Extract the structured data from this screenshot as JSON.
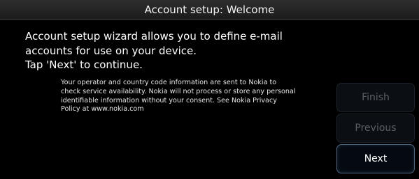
{
  "window": {
    "title": "Account setup: Welcome"
  },
  "main": {
    "intro_lines": [
      "Account setup wizard allows you to define e-mail",
      "accounts for use on your device.",
      "Tap 'Next' to continue."
    ],
    "notice_lines": [
      "Your operator and country code information are sent to Nokia to",
      "check service availability. Nokia will not process or store any personal",
      "identifiable information without your consent. See Nokia Privacy",
      "Policy at www.nokia.com"
    ]
  },
  "buttons": {
    "finish_label": "Finish",
    "previous_label": "Previous",
    "next_label": "Next"
  },
  "colors": {
    "background": "#000000",
    "disabled_text": "#5a6066",
    "active_border": "#4d6680"
  }
}
